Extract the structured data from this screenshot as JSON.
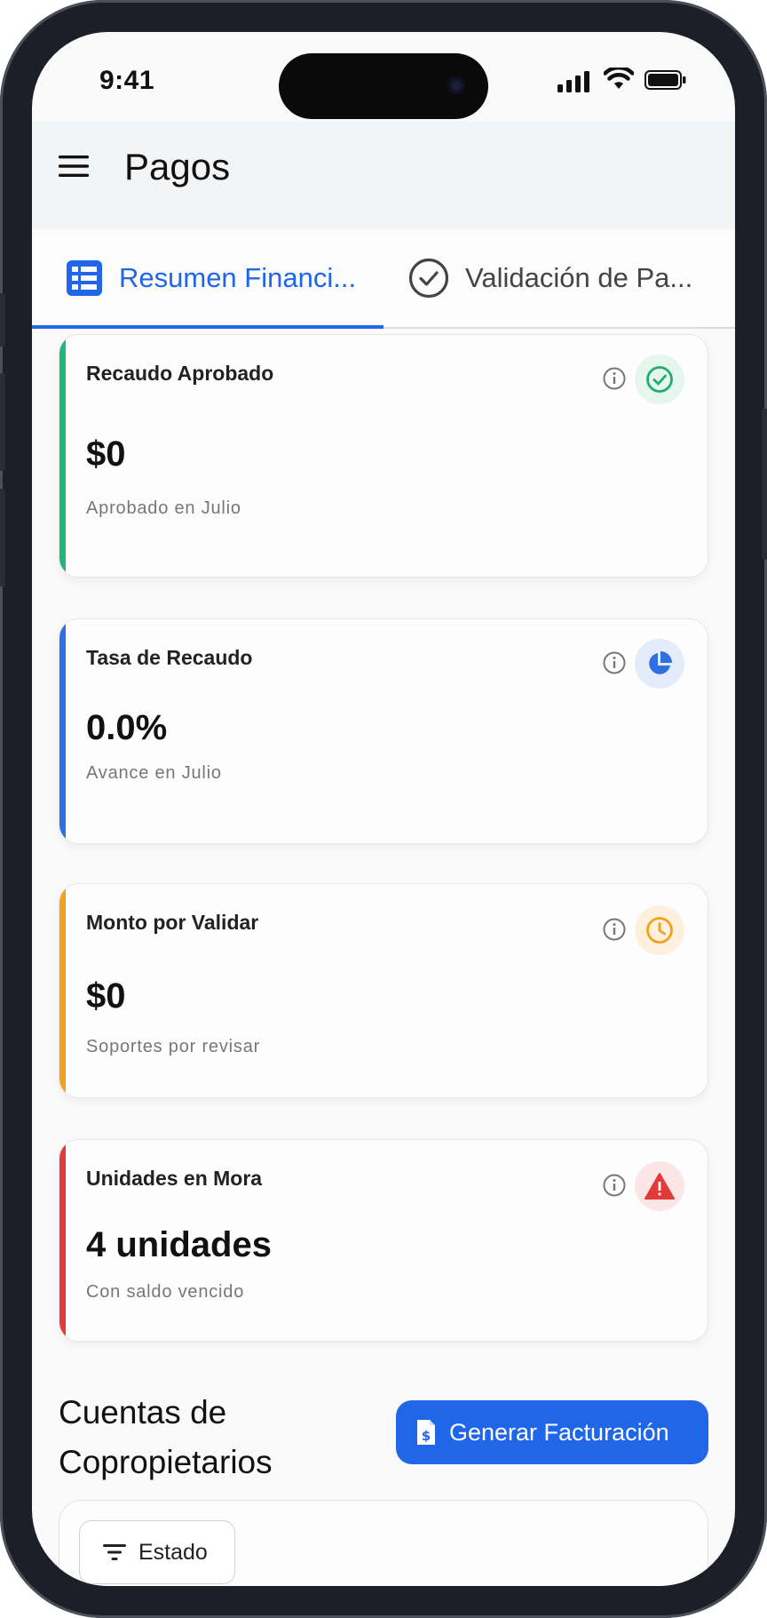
{
  "status_bar": {
    "time": "9:41"
  },
  "app_bar": {
    "title": "Pagos",
    "menu_icon": "hamburger-menu-icon"
  },
  "tabs": [
    {
      "label": "Resumen Financi...",
      "icon": "table-icon",
      "active": true
    },
    {
      "label": "Validación de Pa...",
      "icon": "check-circle-icon",
      "active": false
    }
  ],
  "cards": [
    {
      "label": "Recaudo Aprobado",
      "value": "$0",
      "subtitle": "Aprobado en Julio",
      "accent": "#22b573",
      "badge_bg": "#e5f6ee",
      "icon": "check-circle-icon"
    },
    {
      "label": "Tasa de Recaudo",
      "value": "0.0%",
      "subtitle": "Avance en Julio",
      "accent": "#2f6fe0",
      "badge_bg": "#e4ecfb",
      "icon": "pie-chart-icon"
    },
    {
      "label": "Monto por Validar",
      "value": "$0",
      "subtitle": "Soportes por revisar",
      "accent": "#f2a11c",
      "badge_bg": "#fdf0dd",
      "icon": "clock-icon"
    },
    {
      "label": "Unidades en Mora",
      "value": "4 unidades",
      "subtitle": "Con saldo vencido",
      "accent": "#e03a3a",
      "badge_bg": "#fbe5e5",
      "icon": "warning-icon"
    }
  ],
  "section": {
    "title_line1": "Cuentas de",
    "title_line2": "Copropietarios",
    "generate_button": "Generar Facturación",
    "filter_label": "Estado"
  },
  "colors": {
    "primary": "#1f66e8"
  }
}
